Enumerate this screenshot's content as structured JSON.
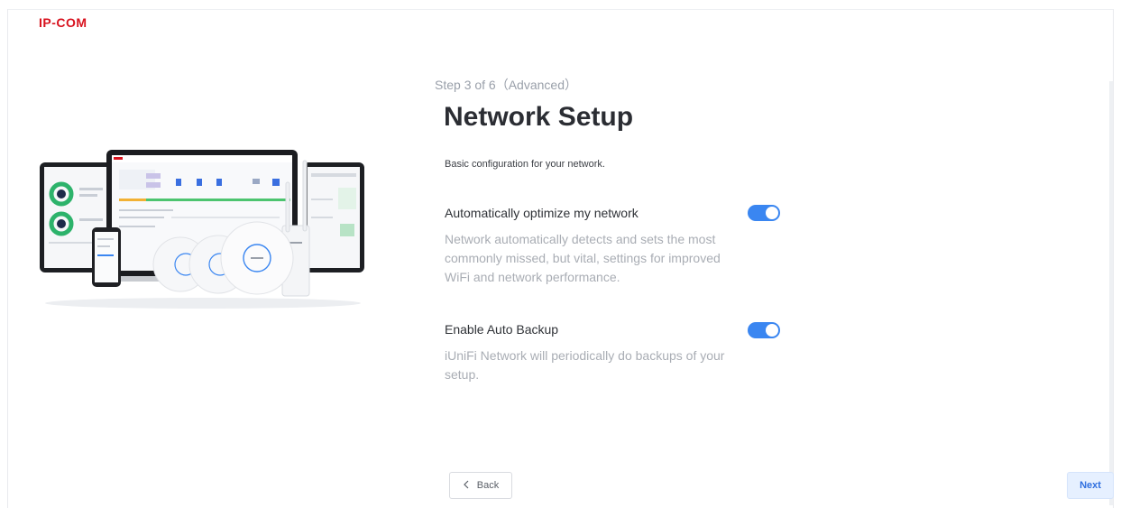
{
  "brand": {
    "logo_text": "IP-COM",
    "logo_color": "#d8121e"
  },
  "wizard": {
    "step_text": "Step 3 of 6（Advanced）",
    "title": "Network Setup",
    "subtitle": "Basic configuration for your network."
  },
  "options": [
    {
      "label": "Automatically optimize my network",
      "description": "Network automatically detects and sets the most commonly missed, but vital, settings for improved WiFi and network performance.",
      "enabled": true
    },
    {
      "label": "Enable Auto Backup",
      "description": "iUniFi Network will periodically do backups of your setup.",
      "enabled": true
    }
  ],
  "footer": {
    "back_label": "Back",
    "back_icon": "chevron-left-icon",
    "next_label": "Next"
  },
  "hero": {
    "alt_icon": "devices-illustration"
  },
  "colors": {
    "accent": "#3a86f1",
    "muted_text": "#a9adb4",
    "next_bg": "#e6f0ff"
  }
}
